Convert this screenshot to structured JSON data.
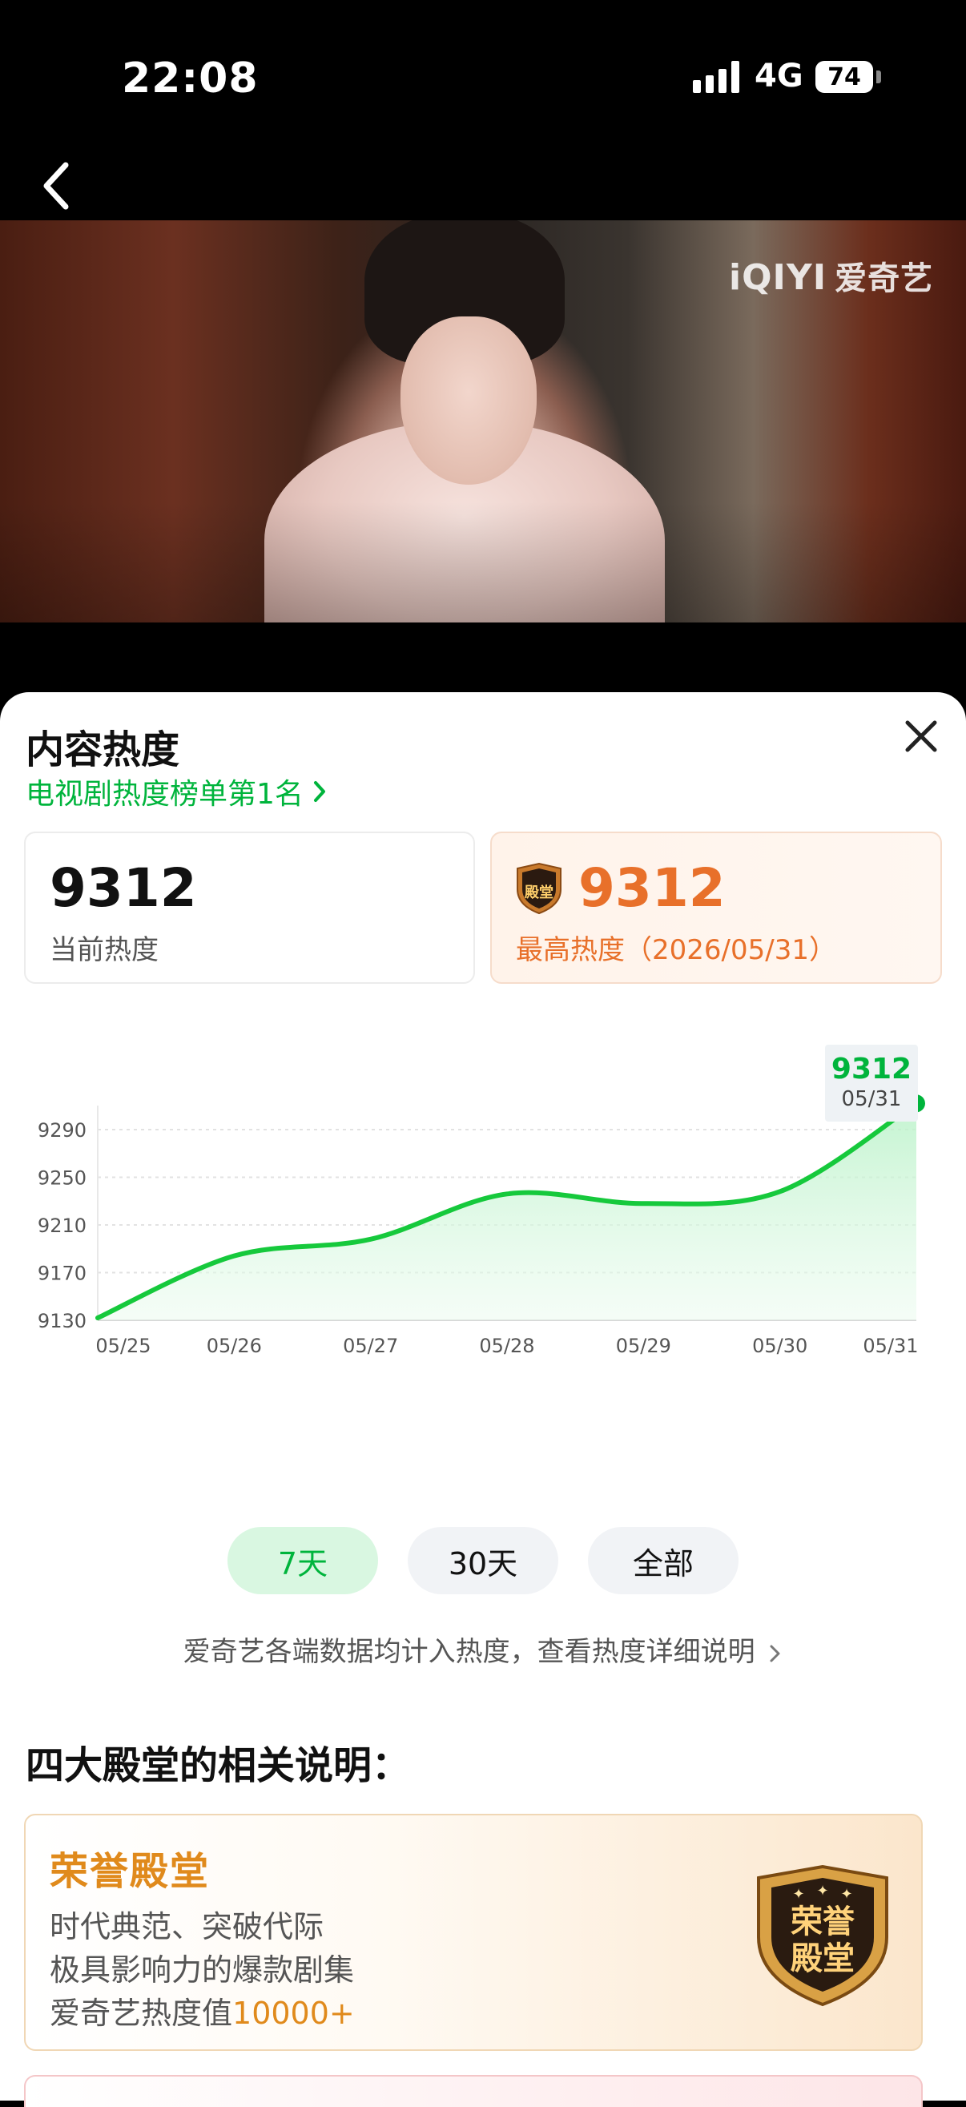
{
  "status_bar": {
    "time": "22:08",
    "network": "4G",
    "battery": "74"
  },
  "video": {
    "watermark": "iQIYI",
    "watermark_cn": "爱奇艺"
  },
  "panel": {
    "title": "内容热度",
    "rank_link": "电视剧热度榜单第1名",
    "current": {
      "value": "9312",
      "label": "当前热度"
    },
    "peak": {
      "value": "9312",
      "label": "最高热度（2026/05/31）",
      "badge_icon": "honor-hall-badge-icon"
    },
    "tooltip": {
      "value": "9312",
      "date": "05/31"
    },
    "range_tabs": [
      {
        "label": "7天",
        "active": true
      },
      {
        "label": "30天",
        "active": false
      },
      {
        "label": "全部",
        "active": false
      }
    ],
    "note": "爱奇艺各端数据均计入热度，查看热度详细说明",
    "section_title": "四大殿堂的相关说明：",
    "hall": {
      "title": "荣誉殿堂",
      "lines": [
        "时代典范、突破代际",
        "极具影响力的爆款剧集"
      ],
      "value_prefix": "爱奇艺热度值",
      "value": "10000+",
      "badge_icon": "honor-hall-badge-icon"
    }
  },
  "colors": {
    "accent": "#00b43c",
    "peak": "#e8702a",
    "hall": "#e08a1c"
  },
  "chart_data": {
    "type": "area",
    "categories": [
      "05/25",
      "05/26",
      "05/27",
      "05/28",
      "05/29",
      "05/30",
      "05/31"
    ],
    "values": [
      9132,
      9184,
      9198,
      9236,
      9228,
      9238,
      9312
    ],
    "y_ticks": [
      "9290",
      "9250",
      "9210",
      "9170",
      "9130"
    ],
    "ylim": [
      9130,
      9312
    ],
    "grid": true
  }
}
